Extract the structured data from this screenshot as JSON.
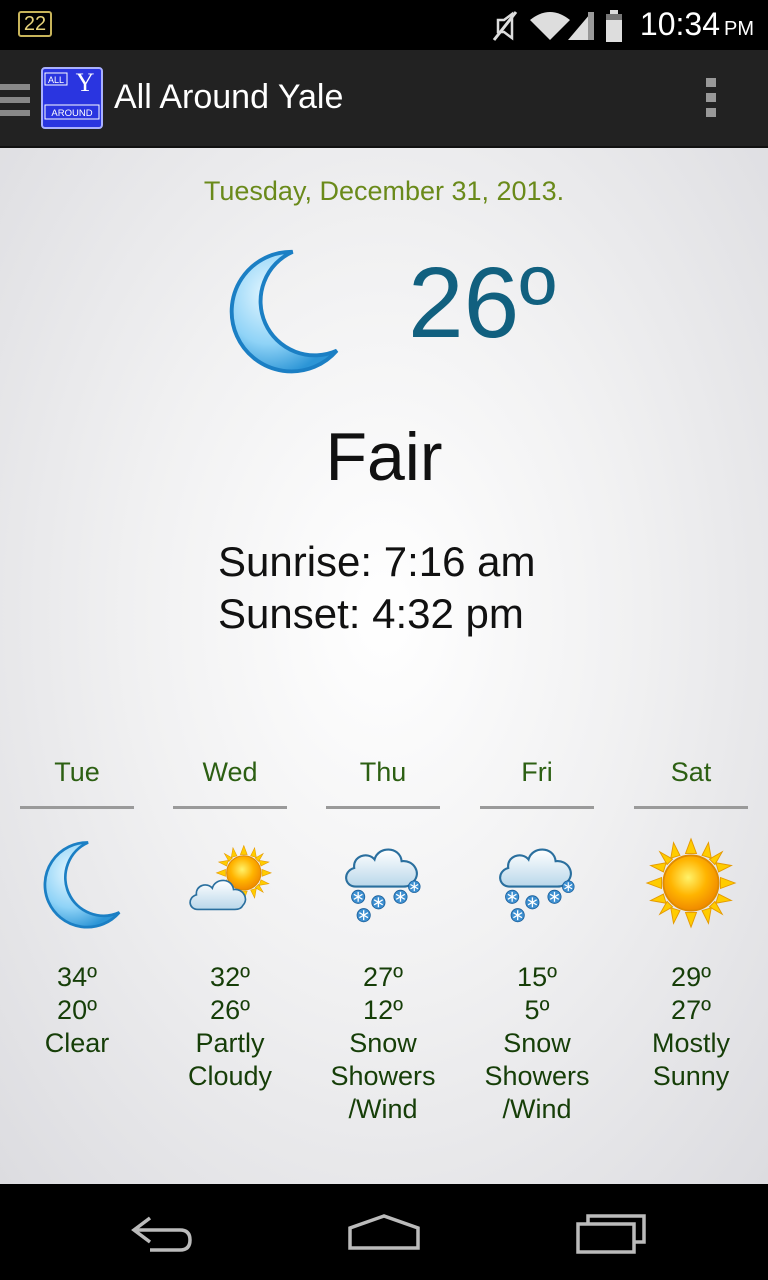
{
  "status_bar": {
    "badge": "22",
    "time": "10:34",
    "ampm": "PM"
  },
  "app_bar": {
    "title": "All Around Yale",
    "logo_text_top": "ALL",
    "logo_letter": "Y",
    "logo_text_bottom": "AROUND"
  },
  "weather": {
    "date": "Tuesday, December 31, 2013.",
    "current_icon": "moon-icon",
    "temperature": "26º",
    "condition": "Fair",
    "sunrise": "Sunrise: 7:16 am",
    "sunset": "Sunset: 4:32 pm"
  },
  "forecast": [
    {
      "day": "Tue",
      "icon": "moon-icon",
      "high": "34º",
      "low": "20º",
      "cond1": "Clear",
      "cond2": "",
      "cond3": ""
    },
    {
      "day": "Wed",
      "icon": "partly-cloudy-icon",
      "high": "32º",
      "low": "26º",
      "cond1": "Partly",
      "cond2": "Cloudy",
      "cond3": ""
    },
    {
      "day": "Thu",
      "icon": "snow-showers-icon",
      "high": "27º",
      "low": "12º",
      "cond1": "Snow",
      "cond2": "Showers",
      "cond3": "/Wind"
    },
    {
      "day": "Fri",
      "icon": "snow-showers-icon",
      "high": "15º",
      "low": "5º",
      "cond1": "Snow",
      "cond2": "Showers",
      "cond3": "/Wind"
    },
    {
      "day": "Sat",
      "icon": "sun-icon",
      "high": "29º",
      "low": "27º",
      "cond1": "Mostly",
      "cond2": "Sunny",
      "cond3": ""
    }
  ],
  "colors": {
    "date_green": "#6a8a1a",
    "temp_blue": "#11607f",
    "forecast_green": "#163e08"
  }
}
